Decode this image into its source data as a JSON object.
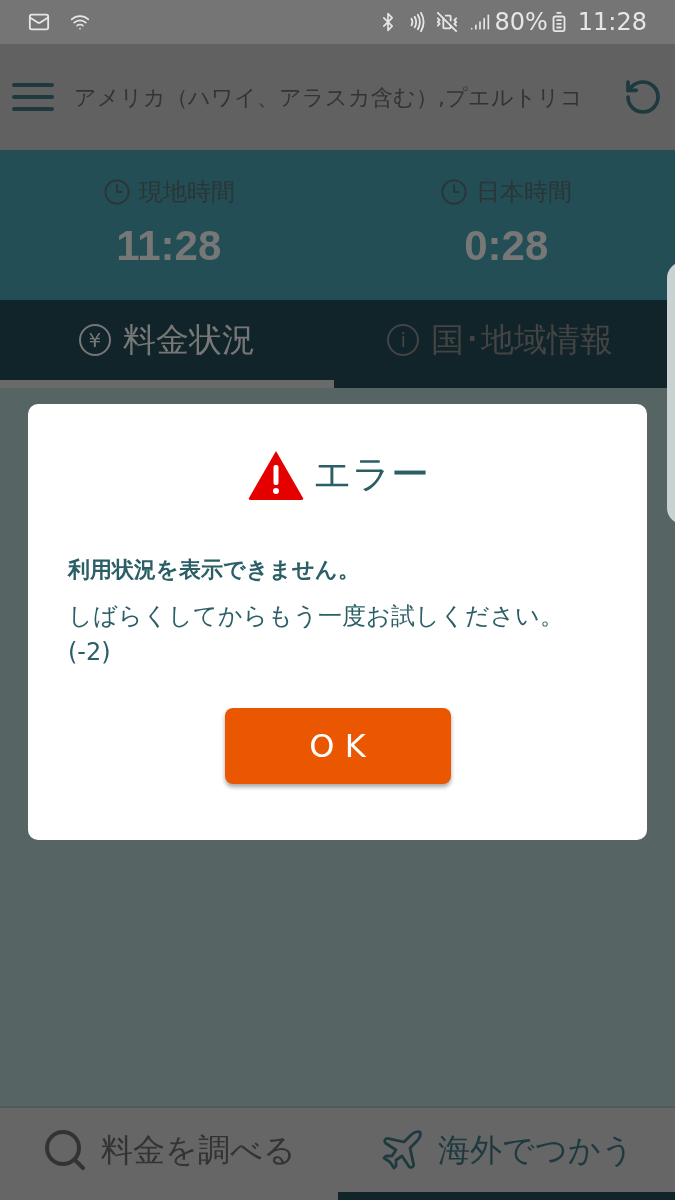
{
  "status_bar": {
    "battery": "80%",
    "time": "11:28"
  },
  "app_bar": {
    "title": "アメリカ（ハワイ、アラスカ含む）,プエルトリコ"
  },
  "clocks": [
    {
      "label": "現地時間",
      "time": "11:28"
    },
    {
      "label": "日本時間",
      "time": "0:28"
    }
  ],
  "tabs": [
    {
      "icon": "¥",
      "label": "料金状況",
      "selected": true
    },
    {
      "icon": "i",
      "label": "国･地域情報",
      "selected": false
    }
  ],
  "dialog": {
    "title": "エラー",
    "heading": "利用状況を表示できません。",
    "message": "しばらくしてからもう一度お試しください。",
    "code": "(-2)",
    "button": "O K"
  },
  "bottom_nav": [
    {
      "kind": "search",
      "label": "料金を調べる",
      "selected": false
    },
    {
      "kind": "plane",
      "label": "海外でつかう",
      "selected": true
    }
  ]
}
